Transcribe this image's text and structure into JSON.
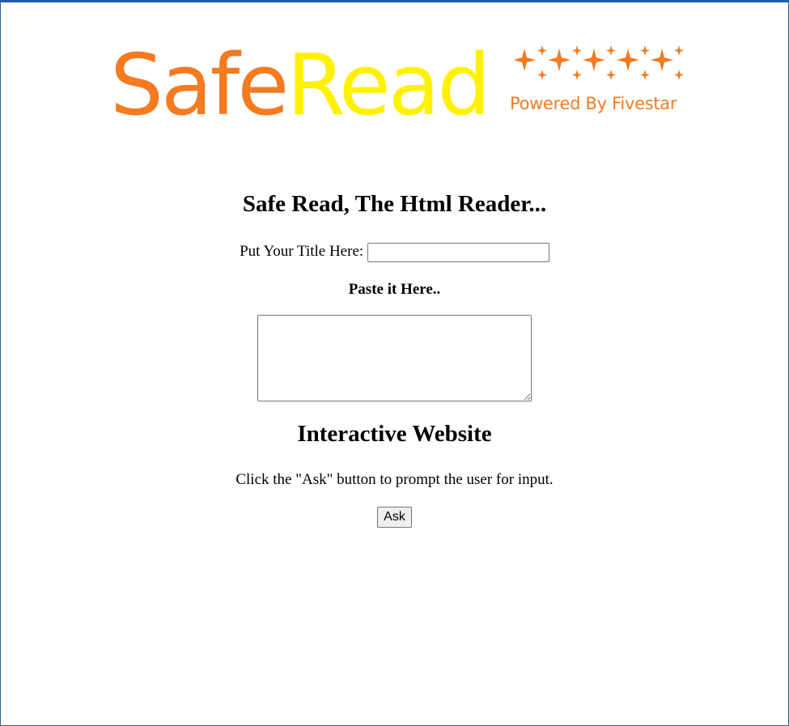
{
  "logo": {
    "word_part1": "Safe",
    "word_part2": "Read",
    "tagline": "Powered By Fivestar",
    "colors": {
      "orange": "#f47b22",
      "yellow": "#fff200"
    },
    "icon": "sparkle-stars"
  },
  "heading": "Safe Read, The Html Reader...",
  "title_field": {
    "label": "Put Your Title Here:",
    "value": ""
  },
  "paste": {
    "label": "Paste it Here..",
    "value": ""
  },
  "section": {
    "heading": "Interactive Website",
    "description": "Click the \"Ask\" button to prompt the user for input.",
    "button_label": "Ask"
  }
}
